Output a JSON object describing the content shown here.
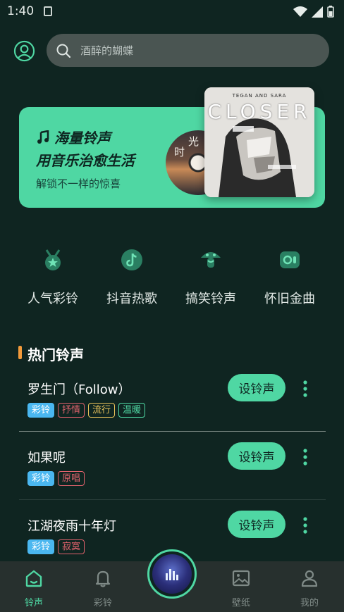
{
  "status_bar": {
    "time": "1:40"
  },
  "search": {
    "placeholder": "酒醉的蝴蝶"
  },
  "banner": {
    "title": "海量铃声",
    "subtitle": "用音乐治愈生活",
    "description": "解锁不一样的惊喜",
    "vinyl_text_1": "时",
    "vinyl_text_2": "光",
    "album_artist": "TEGAN AND SARA",
    "album_title": "CLOSER"
  },
  "categories": [
    {
      "label": "人气彩铃",
      "icon": "medal-icon"
    },
    {
      "label": "抖音热歌",
      "icon": "tiktok-icon"
    },
    {
      "label": "搞笑铃声",
      "icon": "mushroom-icon"
    },
    {
      "label": "怀旧金曲",
      "icon": "recorder-icon"
    }
  ],
  "section": {
    "title": "热门铃声"
  },
  "songs": [
    {
      "title": "罗生门（Follow）",
      "button": "设铃声",
      "tags": [
        {
          "text": "彩铃"
        },
        {
          "text": "抒情"
        },
        {
          "text": "流行"
        },
        {
          "text": "温暖"
        }
      ]
    },
    {
      "title": "如果呢",
      "button": "设铃声",
      "tags": [
        {
          "text": "彩铃"
        },
        {
          "text": "原唱"
        }
      ]
    },
    {
      "title": "江湖夜雨十年灯",
      "button": "设铃声",
      "tags": [
        {
          "text": "彩铃"
        },
        {
          "text": "寂寞"
        }
      ]
    }
  ],
  "tag_colors": {
    "彩铃": "#4ab7f0",
    "抒情": "#e0626c",
    "流行": "#e8c25a",
    "温暖": "#4fd7a3",
    "原唱": "#e0626c",
    "寂寞": "#e0626c"
  },
  "nav": [
    {
      "label": "铃声",
      "icon": "home-icon",
      "active": true
    },
    {
      "label": "彩铃",
      "icon": "bell-icon",
      "active": false
    },
    {
      "label": "壁纸",
      "icon": "image-icon",
      "active": false
    },
    {
      "label": "我的",
      "icon": "user-icon",
      "active": false
    }
  ],
  "colors": {
    "accent": "#4fd7a3",
    "background": "#0f2521",
    "section_marker": "#f29a3a"
  }
}
